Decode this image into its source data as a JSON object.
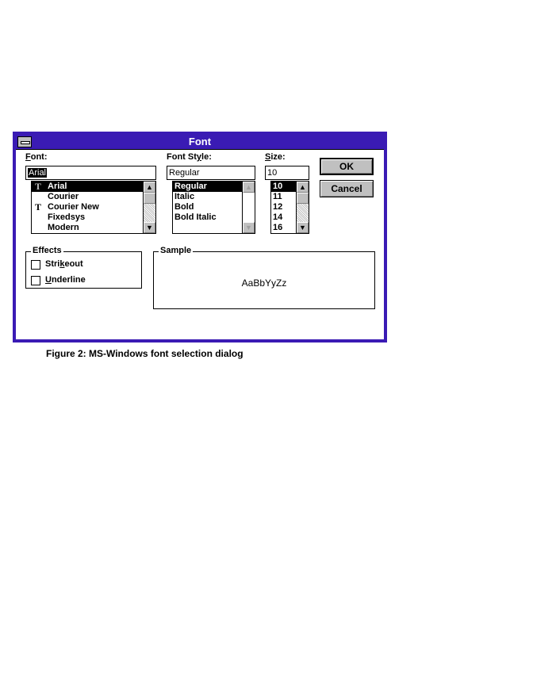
{
  "window": {
    "title": "Font"
  },
  "font": {
    "label_pre": "",
    "label_u": "F",
    "label_post": "ont:",
    "value": "Arial",
    "items": [
      {
        "label": "Arial",
        "truetype": true,
        "selected": true
      },
      {
        "label": "Courier",
        "truetype": false,
        "selected": false
      },
      {
        "label": "Courier New",
        "truetype": true,
        "selected": false
      },
      {
        "label": "Fixedsys",
        "truetype": false,
        "selected": false
      },
      {
        "label": "Modern",
        "truetype": false,
        "selected": false
      }
    ]
  },
  "style": {
    "label_pre": "Font St",
    "label_u": "y",
    "label_post": "le:",
    "value": "Regular",
    "items": [
      {
        "label": "Regular",
        "selected": true
      },
      {
        "label": "Italic",
        "selected": false
      },
      {
        "label": "Bold",
        "selected": false
      },
      {
        "label": "Bold Italic",
        "selected": false
      }
    ]
  },
  "size": {
    "label_pre": "",
    "label_u": "S",
    "label_post": "ize:",
    "value": "10",
    "items": [
      {
        "label": "10",
        "selected": true
      },
      {
        "label": "11",
        "selected": false
      },
      {
        "label": "12",
        "selected": false
      },
      {
        "label": "14",
        "selected": false
      },
      {
        "label": "16",
        "selected": false
      }
    ]
  },
  "buttons": {
    "ok": "OK",
    "cancel": "Cancel"
  },
  "effects": {
    "title": "Effects",
    "strikeout_pre": "Stri",
    "strikeout_u": "k",
    "strikeout_post": "eout",
    "underline_pre": "",
    "underline_u": "U",
    "underline_post": "nderline",
    "strikeout_checked": false,
    "underline_checked": false
  },
  "sample": {
    "title": "Sample",
    "text": "AaBbYyZz"
  },
  "caption": "Figure 2: MS-Windows font selection dialog",
  "icons": {
    "truetype": "T",
    "up": "▲",
    "down": "▼"
  },
  "colors": {
    "titlebar": "#3a1bb4",
    "selection": "#000000"
  }
}
